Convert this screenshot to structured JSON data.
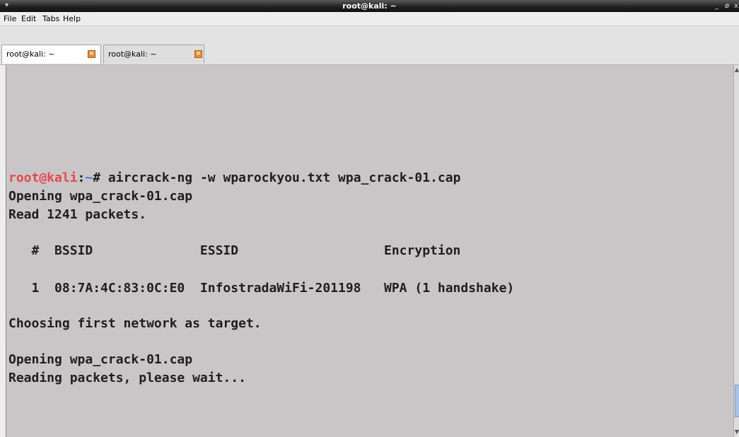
{
  "window": {
    "title": "root@kali: ~",
    "controls": {
      "minimize": "_",
      "maximize": "ø",
      "close": "x"
    }
  },
  "menu": [
    {
      "label": "File"
    },
    {
      "label": "Edit"
    },
    {
      "label": "Tabs"
    },
    {
      "label": "Help"
    }
  ],
  "tabs": [
    {
      "label": "root@kali: ~",
      "close_icon": "close-icon",
      "active": true
    },
    {
      "label": "root@kali: ~",
      "close_icon": "close-icon",
      "active": false
    }
  ],
  "terminal": {
    "prompt_user": "root@kali",
    "prompt_sep": ":",
    "prompt_path": "~",
    "prompt_symbol": "# ",
    "command": "aircrack-ng -w wparockyou.txt wpa_crack-01.cap",
    "lines": [
      "Opening wpa_crack-01.cap",
      "Read 1241 packets.",
      "   #  BSSID              ESSID                   Encryption",
      "   1  08:7A:4C:83:0C:E0  InfostradaWiFi-201198   WPA (1 handshake)",
      "Choosing first network as target.",
      "Opening wpa_crack-01.cap",
      "Reading packets, please wait..."
    ],
    "colors": {
      "background": "#c8c6c6",
      "text": "#1f1f1f",
      "prompt_user": "#e8484f",
      "prompt_path": "#4a7ad6"
    }
  },
  "scrollbar": {
    "up_icon": "▲",
    "down_icon": "▼"
  }
}
